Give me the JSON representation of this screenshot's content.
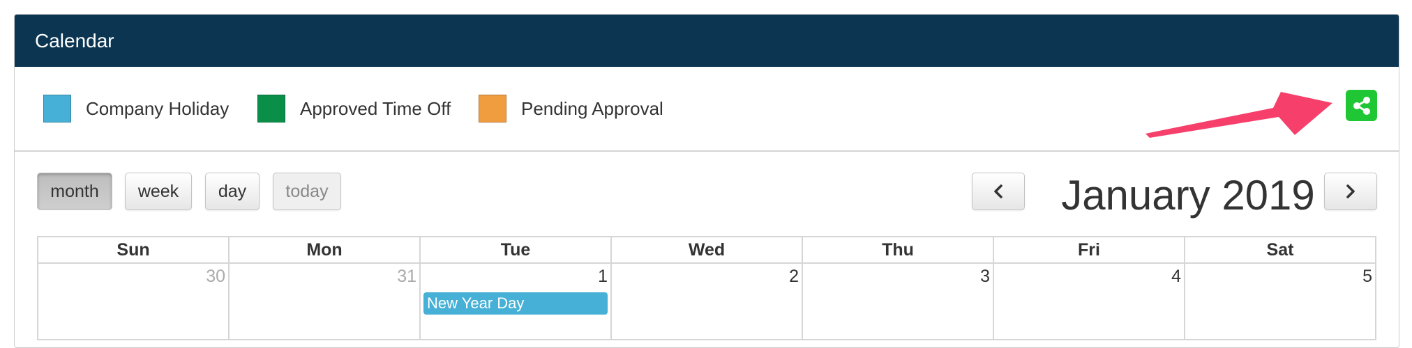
{
  "panel": {
    "title": "Calendar"
  },
  "legend": [
    {
      "label": "Company Holiday",
      "color": "#46b0d6"
    },
    {
      "label": "Approved Time Off",
      "color": "#0a8f48"
    },
    {
      "label": "Pending Approval",
      "color": "#f09d40"
    }
  ],
  "share": {
    "icon": "share-icon",
    "color": "#1ec733"
  },
  "annotation": {
    "icon": "arrow-icon",
    "color": "#f63f6b"
  },
  "toolbar": {
    "month_label": "month",
    "week_label": "week",
    "day_label": "day",
    "today_label": "today",
    "prev_icon": "chevron-left-icon",
    "next_icon": "chevron-right-icon",
    "title": "January 2019"
  },
  "calendar": {
    "weekdays": [
      "Sun",
      "Mon",
      "Tue",
      "Wed",
      "Thu",
      "Fri",
      "Sat"
    ],
    "days": [
      "30",
      "31",
      "1",
      "2",
      "3",
      "4",
      "5"
    ],
    "event": {
      "label": "New Year Day",
      "color": "#46b0d6"
    }
  }
}
